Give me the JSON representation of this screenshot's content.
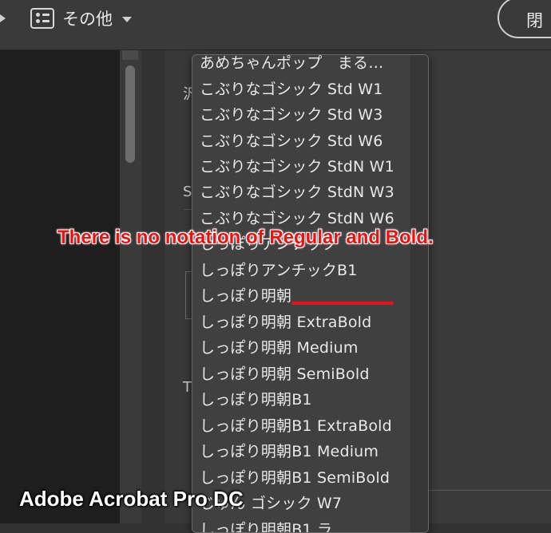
{
  "toolbar": {
    "more_label": "その他",
    "close_label": "閉",
    "list_icon": "list-icon",
    "caret_icon": "caret-down-icon"
  },
  "peek_chars": [
    "汎",
    "S",
    "T"
  ],
  "dropdown": {
    "items": [
      "あめちゃんポップ　まる…",
      "こぶりなゴシック Std W1",
      "こぶりなゴシック Std W3",
      "こぶりなゴシック Std W6",
      "こぶりなゴシック StdN W1",
      "こぶりなゴシック StdN W3",
      "こぶりなゴシック StdN W6",
      "しっぽりアンチック",
      "しっぽりアンチックB1",
      "しっぽり明朝",
      "しっぽり明朝 ExtraBold",
      "しっぽり明朝 Medium",
      "しっぽり明朝 SemiBold",
      "しっぽり明朝B1",
      "しっぽり明朝B1 ExtraBold",
      "しっぽり明朝B1 Medium",
      "しっぽり明朝B1 SemiBold",
      "じゅん ゴシック W7",
      "しっぽり明朝B1 ラ"
    ]
  },
  "annotation": {
    "note": "There is no notation of Regular and Bold.",
    "caption": "Adobe Acrobat Pro DC",
    "color": "#ee1111"
  }
}
